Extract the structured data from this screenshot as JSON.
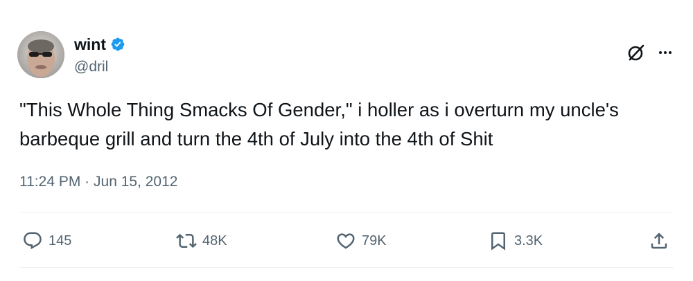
{
  "author": {
    "display_name": "wint",
    "handle": "@dril",
    "verified": true,
    "verified_color": "#1d9bf0"
  },
  "tweet": {
    "text": "\"This Whole Thing Smacks Of Gender,\" i holler as i overturn my uncle's barbeque grill and turn the 4th of July into the 4th of Shit",
    "time": "11:24 PM",
    "separator": "·",
    "date": "Jun 15, 2012"
  },
  "actions": {
    "replies": "145",
    "retweets": "48K",
    "likes": "79K",
    "bookmarks": "3.3K"
  },
  "icons": [
    "grok-icon",
    "more-icon",
    "reply-icon",
    "retweet-icon",
    "like-icon",
    "bookmark-icon",
    "share-icon"
  ],
  "colors": {
    "text": "#0f1419",
    "secondary": "#536471",
    "divider": "#eff3f4"
  }
}
